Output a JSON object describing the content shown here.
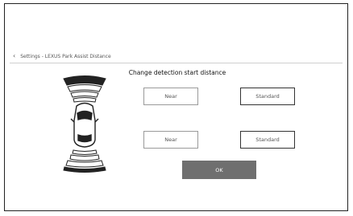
{
  "header": {
    "breadcrumb": "Settings - LEXUS Park Assist Distance"
  },
  "page": {
    "title": "Change detection start distance"
  },
  "front": {
    "near_label": "Near",
    "standard_label": "Standard",
    "selected": "Standard"
  },
  "rear": {
    "near_label": "Near",
    "standard_label": "Standard",
    "selected": "Standard"
  },
  "ok_label": "OK",
  "icons": {
    "back": "chevron-left-icon",
    "car": "car-top-view-icon"
  }
}
